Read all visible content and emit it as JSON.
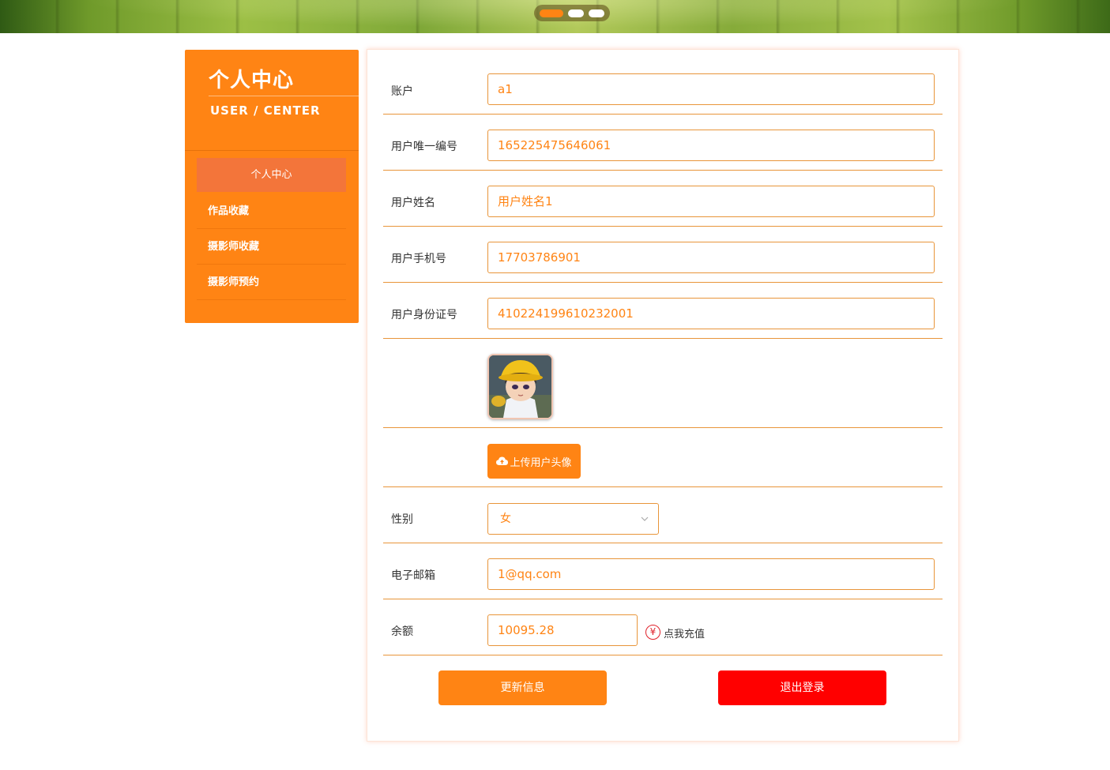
{
  "banner": {
    "dots": 3,
    "active_dot": 0
  },
  "sidebar": {
    "title": "个人中心",
    "subtitle": "USER / CENTER",
    "items": [
      {
        "label": "个人中心",
        "active": true
      },
      {
        "label": "作品收藏",
        "active": false
      },
      {
        "label": "摄影师收藏",
        "active": false
      },
      {
        "label": "摄影师预约",
        "active": false
      }
    ]
  },
  "form": {
    "account": {
      "label": "账户",
      "value": "a1"
    },
    "user_id": {
      "label": "用户唯一编号",
      "value": "165225475646061"
    },
    "user_name": {
      "label": "用户姓名",
      "value": "用户姓名1"
    },
    "phone": {
      "label": "用户手机号",
      "value": "17703786901"
    },
    "id_card": {
      "label": "用户身份证号",
      "value": "410224199610232001"
    },
    "upload_avatar_label": "上传用户头像",
    "gender": {
      "label": "性别",
      "value": "女"
    },
    "email": {
      "label": "电子邮箱",
      "value": "1@qq.com"
    },
    "balance": {
      "label": "余额",
      "value": "10095.28",
      "recharge_label": "点我充值",
      "currency_symbol": "¥"
    }
  },
  "actions": {
    "update_label": "更新信息",
    "logout_label": "退出登录"
  },
  "colors": {
    "accent": "#ff8414",
    "sidebar_active": "#f3753a",
    "danger": "#ff0000",
    "border": "#e8953a"
  }
}
